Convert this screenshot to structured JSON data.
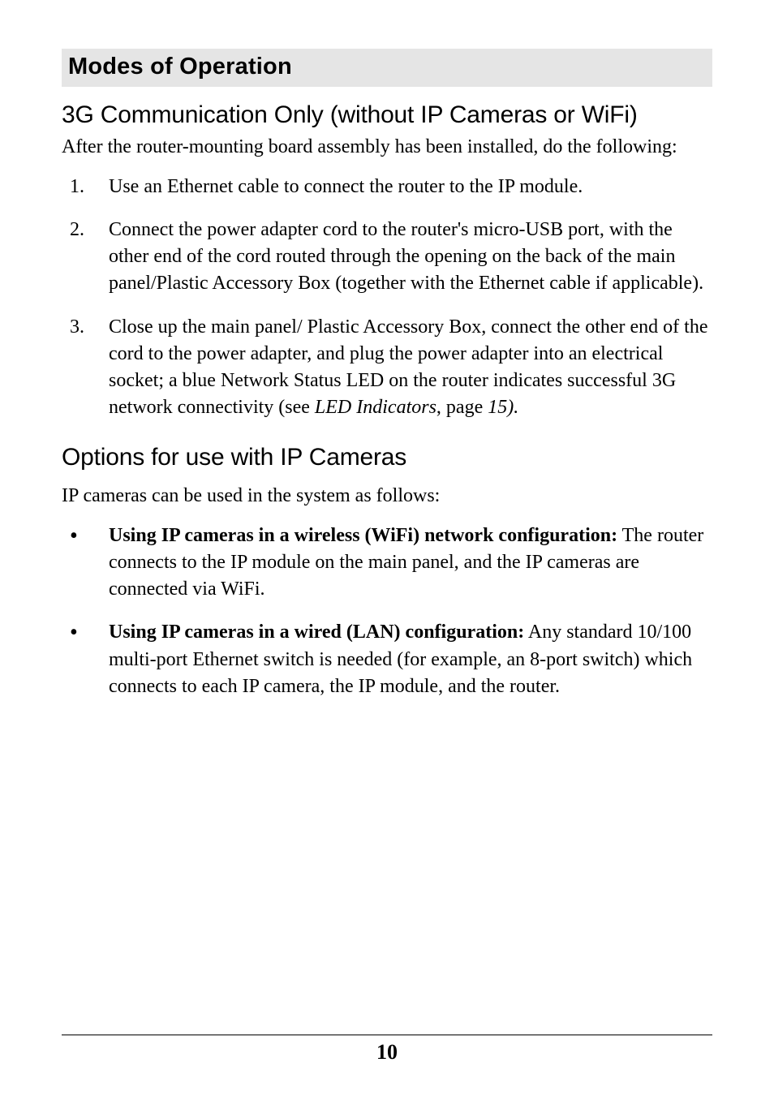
{
  "section_title": "Modes of Operation",
  "sub1_title": "3G Communication Only (without IP Cameras or WiFi)",
  "sub1_intro": "After the router-mounting board assembly has been installed, do the following:",
  "steps": {
    "s1": "Use an Ethernet cable to connect the router to the IP module.",
    "s2": "Connect the power adapter cord to the router's micro-USB port, with the other end of the cord routed through the opening on the back of the main panel/Plastic Accessory Box (together with the Ethernet cable if applicable).",
    "s3_a": "Close up the main panel/ Plastic Accessory Box, connect the other end of the cord to the power adapter, and plug the power adapter into an electrical socket; a blue Network Status LED on the router indicates successful 3G network connectivity (see ",
    "s3_i1": "LED Indicators",
    "s3_b": ", page ",
    "s3_i2": "15).",
    "s3_full": "Close up the main panel/ Plastic Accessory Box, connect the other end of the cord to the power adapter, and plug the power adapter into an electrical socket; a blue Network Status LED on the router indicates successful 3G network connectivity (see LED Indicators, page 15)."
  },
  "sub2_title": "Options for use with IP Cameras",
  "sub2_intro": "IP cameras can be used in the system as follows:",
  "bullets": {
    "b1_lead": " Using IP cameras in a wireless (WiFi) network configuration:",
    "b1_rest": " The router connects to the IP module on the main panel, and the IP cameras are connected via WiFi.",
    "b2_lead": "Using IP cameras in a wired (LAN) configuration:",
    "b2_rest": " Any standard 10/100 multi-port Ethernet switch is needed (for example, an 8-port switch) which connects to each IP camera, the IP module, and the router."
  },
  "page_number": "10"
}
